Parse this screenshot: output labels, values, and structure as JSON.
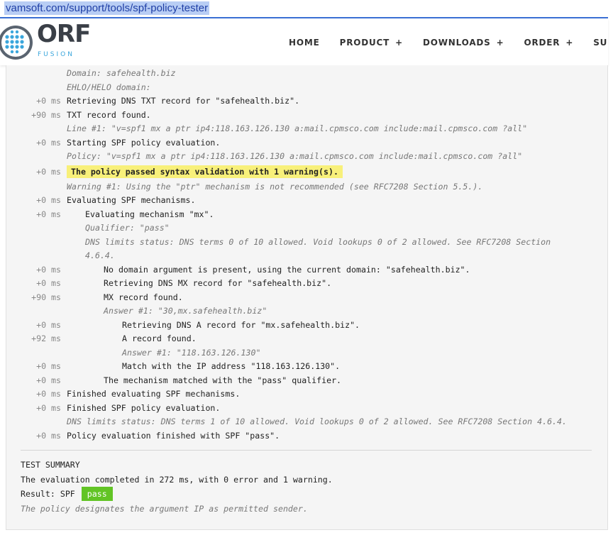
{
  "browser": {
    "url": "vamsoft.com/support/tools/spf-policy-tester"
  },
  "header": {
    "logo_text": "ORF",
    "logo_subtext": "FUSION",
    "nav": [
      {
        "label": "HOME",
        "has_plus": false
      },
      {
        "label": "PRODUCT",
        "has_plus": true
      },
      {
        "label": "DOWNLOADS",
        "has_plus": true
      },
      {
        "label": "ORDER",
        "has_plus": true
      },
      {
        "label": "SUPPO",
        "has_plus": false
      }
    ]
  },
  "log": [
    {
      "time": "",
      "indent": 0,
      "style": "italic",
      "text": "Domain: safehealth.biz"
    },
    {
      "time": "",
      "indent": 0,
      "style": "italic",
      "text": "EHLO/HELO domain:"
    },
    {
      "time": "+0 ms",
      "indent": 0,
      "style": "normal",
      "text": "Retrieving DNS TXT record for \"safehealth.biz\"."
    },
    {
      "time": "+90 ms",
      "indent": 0,
      "style": "normal",
      "text": "TXT record found."
    },
    {
      "time": "",
      "indent": 0,
      "style": "italic",
      "text": "Line #1: \"v=spf1 mx a ptr ip4:118.163.126.130 a:mail.cpmsco.com include:mail.cpmsco.com ?all\""
    },
    {
      "time": "+0 ms",
      "indent": 0,
      "style": "normal",
      "text": "Starting SPF policy evaluation."
    },
    {
      "time": "",
      "indent": 0,
      "style": "italic",
      "text": "Policy: \"v=spf1 mx a ptr ip4:118.163.126.130 a:mail.cpmsco.com include:mail.cpmsco.com ?all\""
    },
    {
      "time": "+0 ms",
      "indent": 0,
      "style": "highlight",
      "text": "The policy passed syntax validation with 1 warning(s)."
    },
    {
      "time": "",
      "indent": 0,
      "style": "italic",
      "text": "Warning #1: Using the \"ptr\" mechanism is not recommended (see RFC7208 Section 5.5.)."
    },
    {
      "time": "+0 ms",
      "indent": 0,
      "style": "normal",
      "text": "Evaluating SPF mechanisms."
    },
    {
      "time": "+0 ms",
      "indent": 1,
      "style": "normal",
      "text": "Evaluating mechanism \"mx\"."
    },
    {
      "time": "",
      "indent": 1,
      "style": "italic",
      "text": "Qualifier: \"pass\""
    },
    {
      "time": "",
      "indent": 1,
      "style": "italic",
      "text": "DNS limits status: DNS terms 0 of 10 allowed. Void lookups 0 of 2 allowed. See RFC7208 Section"
    },
    {
      "time": "",
      "indent": 1,
      "style": "italic",
      "text": "4.6.4."
    },
    {
      "time": "+0 ms",
      "indent": 2,
      "style": "normal",
      "text": "No domain argument is present, using the current domain: \"safehealth.biz\"."
    },
    {
      "time": "+0 ms",
      "indent": 2,
      "style": "normal",
      "text": "Retrieving DNS MX record for \"safehealth.biz\"."
    },
    {
      "time": "+90 ms",
      "indent": 2,
      "style": "normal",
      "text": "MX record found."
    },
    {
      "time": "",
      "indent": 2,
      "style": "italic",
      "text": "Answer #1: \"30,mx.safehealth.biz\""
    },
    {
      "time": "+0 ms",
      "indent": 3,
      "style": "normal",
      "text": "Retrieving DNS A record for \"mx.safehealth.biz\"."
    },
    {
      "time": "+92 ms",
      "indent": 3,
      "style": "normal",
      "text": "A record found."
    },
    {
      "time": "",
      "indent": 3,
      "style": "italic",
      "text": "Answer #1: \"118.163.126.130\""
    },
    {
      "time": "+0 ms",
      "indent": 3,
      "style": "normal",
      "text": "Match with the IP address \"118.163.126.130\"."
    },
    {
      "time": "+0 ms",
      "indent": 2,
      "style": "normal",
      "text": "The mechanism matched with the \"pass\" qualifier."
    },
    {
      "time": "+0 ms",
      "indent": 0,
      "style": "normal",
      "text": "Finished evaluating SPF mechanisms."
    },
    {
      "time": "+0 ms",
      "indent": 0,
      "style": "normal",
      "text": "Finished SPF policy evaluation."
    },
    {
      "time": "",
      "indent": 0,
      "style": "italic",
      "text": "DNS limits status: DNS terms 1 of 10 allowed. Void lookups 0 of 2 allowed. See RFC7208 Section 4.6.4."
    },
    {
      "time": "+0 ms",
      "indent": 0,
      "style": "normal",
      "text": "Policy evaluation finished with SPF \"pass\"."
    }
  ],
  "summary": {
    "heading": "TEST SUMMARY",
    "line": "The evaluation completed in 272 ms, with 0 error and 1 warning.",
    "result_label": "Result: SPF",
    "result_badge": "pass",
    "result_color": "#62c425",
    "note": "The policy designates the argument IP as permitted sender."
  }
}
